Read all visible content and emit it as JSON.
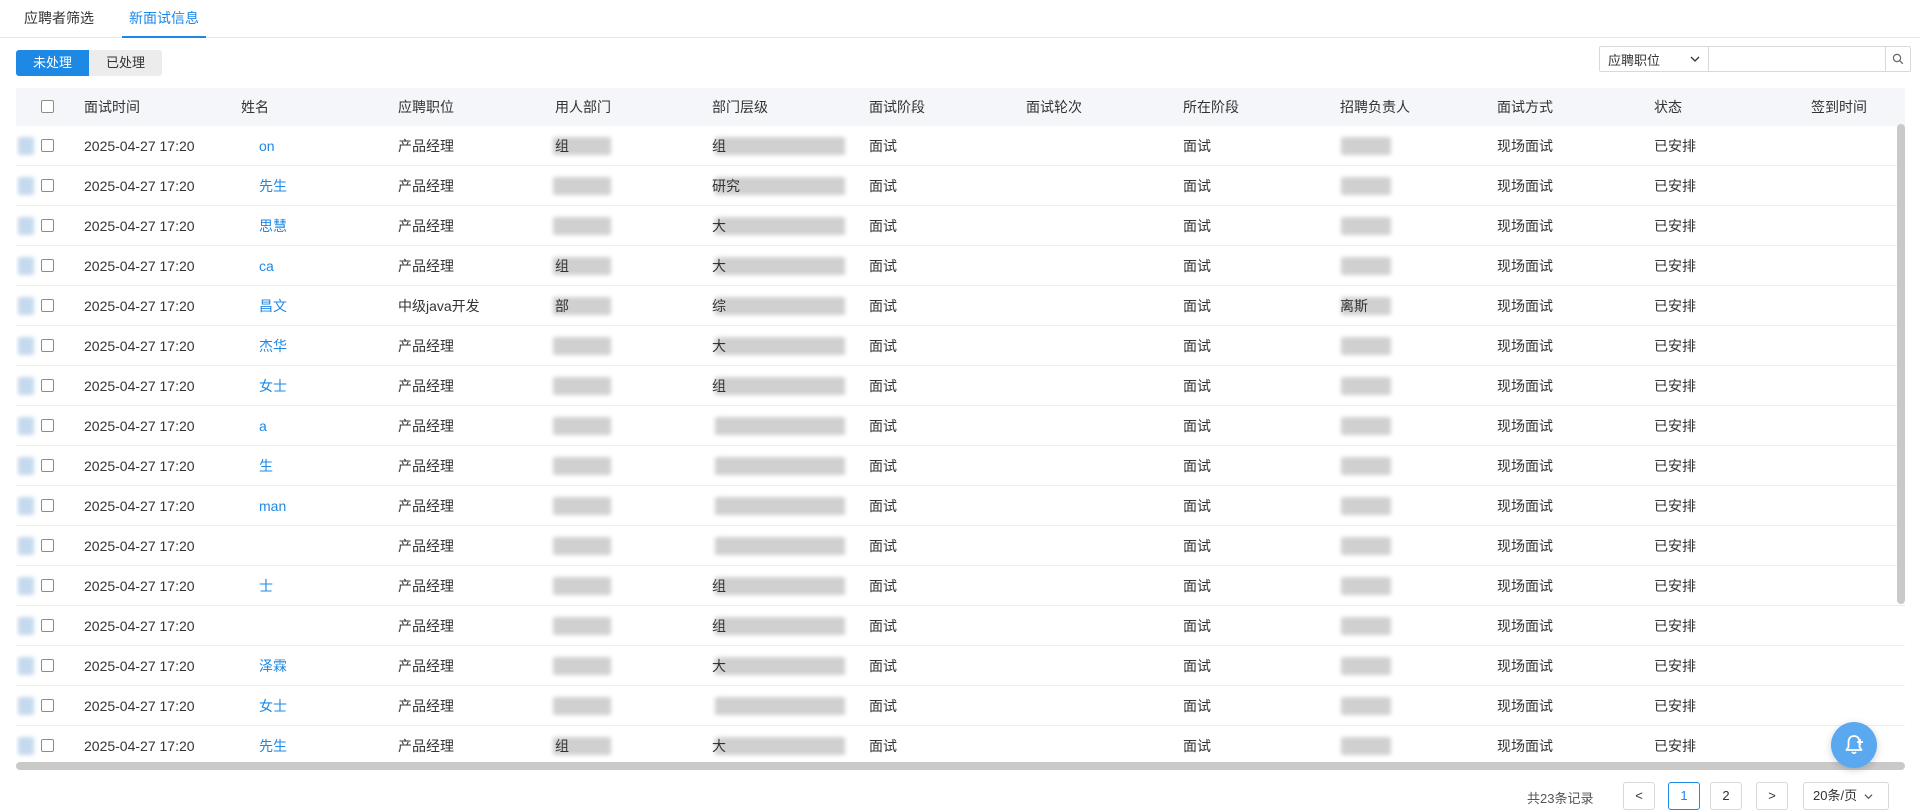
{
  "tabs": [
    "应聘者筛选",
    "新面试信息"
  ],
  "toolbar": {
    "unprocessed": "未处理",
    "processed": "已处理",
    "position_filter": "应聘职位",
    "search_placeholder": ""
  },
  "columns": [
    "面试时间",
    "姓名",
    "应聘职位",
    "用人部门",
    "部门层级",
    "面试阶段",
    "面试轮次",
    "所在阶段",
    "招聘负责人",
    "面试方式",
    "状态",
    "签到时间"
  ],
  "rows": [
    {
      "time": "2025-04-27 17:20",
      "name": "on",
      "position": "产品经理",
      "dept": "组",
      "level": "组",
      "phase": "面试",
      "round": "",
      "stage": "面试",
      "owner": "",
      "mode": "现场面试",
      "status": "已安排",
      "signin": ""
    },
    {
      "time": "2025-04-27 17:20",
      "name": "先生",
      "position": "产品经理",
      "dept": "",
      "level": "研究",
      "phase": "面试",
      "round": "",
      "stage": "面试",
      "owner": "",
      "mode": "现场面试",
      "status": "已安排",
      "signin": ""
    },
    {
      "time": "2025-04-27 17:20",
      "name": "思慧",
      "position": "产品经理",
      "dept": "",
      "level": "大",
      "phase": "面试",
      "round": "",
      "stage": "面试",
      "owner": "",
      "mode": "现场面试",
      "status": "已安排",
      "signin": ""
    },
    {
      "time": "2025-04-27 17:20",
      "name": "ca",
      "position": "产品经理",
      "dept": "组",
      "level": "大",
      "phase": "面试",
      "round": "",
      "stage": "面试",
      "owner": "",
      "mode": "现场面试",
      "status": "已安排",
      "signin": ""
    },
    {
      "time": "2025-04-27 17:20",
      "name": "昌文",
      "position": "中级java开发",
      "dept": "部",
      "level": "综",
      "phase": "面试",
      "round": "",
      "stage": "面试",
      "owner": "离斯",
      "mode": "现场面试",
      "status": "已安排",
      "signin": ""
    },
    {
      "time": "2025-04-27 17:20",
      "name": "杰华",
      "position": "产品经理",
      "dept": "",
      "level": "大",
      "phase": "面试",
      "round": "",
      "stage": "面试",
      "owner": "",
      "mode": "现场面试",
      "status": "已安排",
      "signin": ""
    },
    {
      "time": "2025-04-27 17:20",
      "name": "女士",
      "position": "产品经理",
      "dept": "",
      "level": "组",
      "phase": "面试",
      "round": "",
      "stage": "面试",
      "owner": "",
      "mode": "现场面试",
      "status": "已安排",
      "signin": ""
    },
    {
      "time": "2025-04-27 17:20",
      "name": "a",
      "position": "产品经理",
      "dept": "",
      "level": "",
      "phase": "面试",
      "round": "",
      "stage": "面试",
      "owner": "",
      "mode": "现场面试",
      "status": "已安排",
      "signin": ""
    },
    {
      "time": "2025-04-27 17:20",
      "name": "生",
      "position": "产品经理",
      "dept": "",
      "level": "",
      "phase": "面试",
      "round": "",
      "stage": "面试",
      "owner": "",
      "mode": "现场面试",
      "status": "已安排",
      "signin": ""
    },
    {
      "time": "2025-04-27 17:20",
      "name": "man",
      "position": "产品经理",
      "dept": "",
      "level": "",
      "phase": "面试",
      "round": "",
      "stage": "面试",
      "owner": "",
      "mode": "现场面试",
      "status": "已安排",
      "signin": ""
    },
    {
      "time": "2025-04-27 17:20",
      "name": "",
      "position": "产品经理",
      "dept": "",
      "level": "",
      "phase": "面试",
      "round": "",
      "stage": "面试",
      "owner": "",
      "mode": "现场面试",
      "status": "已安排",
      "signin": ""
    },
    {
      "time": "2025-04-27 17:20",
      "name": "士",
      "position": "产品经理",
      "dept": "",
      "level": "组",
      "phase": "面试",
      "round": "",
      "stage": "面试",
      "owner": "",
      "mode": "现场面试",
      "status": "已安排",
      "signin": ""
    },
    {
      "time": "2025-04-27 17:20",
      "name": "",
      "position": "产品经理",
      "dept": "",
      "level": "组",
      "phase": "面试",
      "round": "",
      "stage": "面试",
      "owner": "",
      "mode": "现场面试",
      "status": "已安排",
      "signin": ""
    },
    {
      "time": "2025-04-27 17:20",
      "name": "泽霖",
      "position": "产品经理",
      "dept": "",
      "level": "大",
      "phase": "面试",
      "round": "",
      "stage": "面试",
      "owner": "",
      "mode": "现场面试",
      "status": "已安排",
      "signin": ""
    },
    {
      "time": "2025-04-27 17:20",
      "name": "女士",
      "position": "产品经理",
      "dept": "",
      "level": "",
      "phase": "面试",
      "round": "",
      "stage": "面试",
      "owner": "",
      "mode": "现场面试",
      "status": "已安排",
      "signin": ""
    },
    {
      "time": "2025-04-27 17:20",
      "name": "先生",
      "position": "产品经理",
      "dept": "组",
      "level": "大",
      "phase": "面试",
      "round": "",
      "stage": "面试",
      "owner": "",
      "mode": "现场面试",
      "status": "已安排",
      "signin": ""
    }
  ],
  "pagination": {
    "total_text": "共23条记录",
    "prev": "<",
    "pages": [
      "1",
      "2"
    ],
    "next": ">",
    "page_size": "20条/页"
  }
}
